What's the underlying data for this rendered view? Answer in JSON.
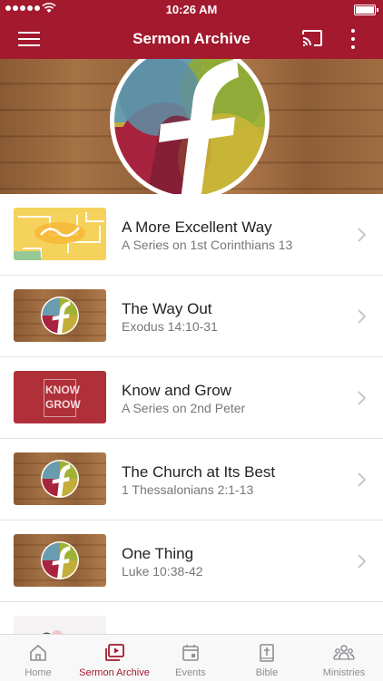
{
  "status": {
    "time": "10:26 AM"
  },
  "nav": {
    "title": "Sermon Archive",
    "menu_icon": "hamburger-menu-icon",
    "cast_icon": "cast-icon",
    "more_icon": "more-vertical-icon"
  },
  "colors": {
    "brand": "#a3192e",
    "tab_inactive": "#8e8e93"
  },
  "sermons": [
    {
      "title": "A More Excellent Way",
      "subtitle": "A Series on 1st Corinthians 13"
    },
    {
      "title": "The Way Out",
      "subtitle": "Exodus 14:10-31"
    },
    {
      "title": "Know and Grow",
      "subtitle": "A Series on 2nd Peter",
      "thumb_text_1": "KNOW",
      "thumb_text_2": "GROW"
    },
    {
      "title": "The Church at Its Best",
      "subtitle": "1 Thessalonians 2:1-13"
    },
    {
      "title": "One Thing",
      "subtitle": "Luke 10:38-42"
    }
  ],
  "tabs": [
    {
      "label": "Home",
      "icon": "home-icon"
    },
    {
      "label": "Sermon Archive",
      "icon": "video-library-icon",
      "active": true
    },
    {
      "label": "Events",
      "icon": "calendar-icon"
    },
    {
      "label": "Bible",
      "icon": "bible-icon"
    },
    {
      "label": "Ministries",
      "icon": "people-group-icon"
    }
  ]
}
